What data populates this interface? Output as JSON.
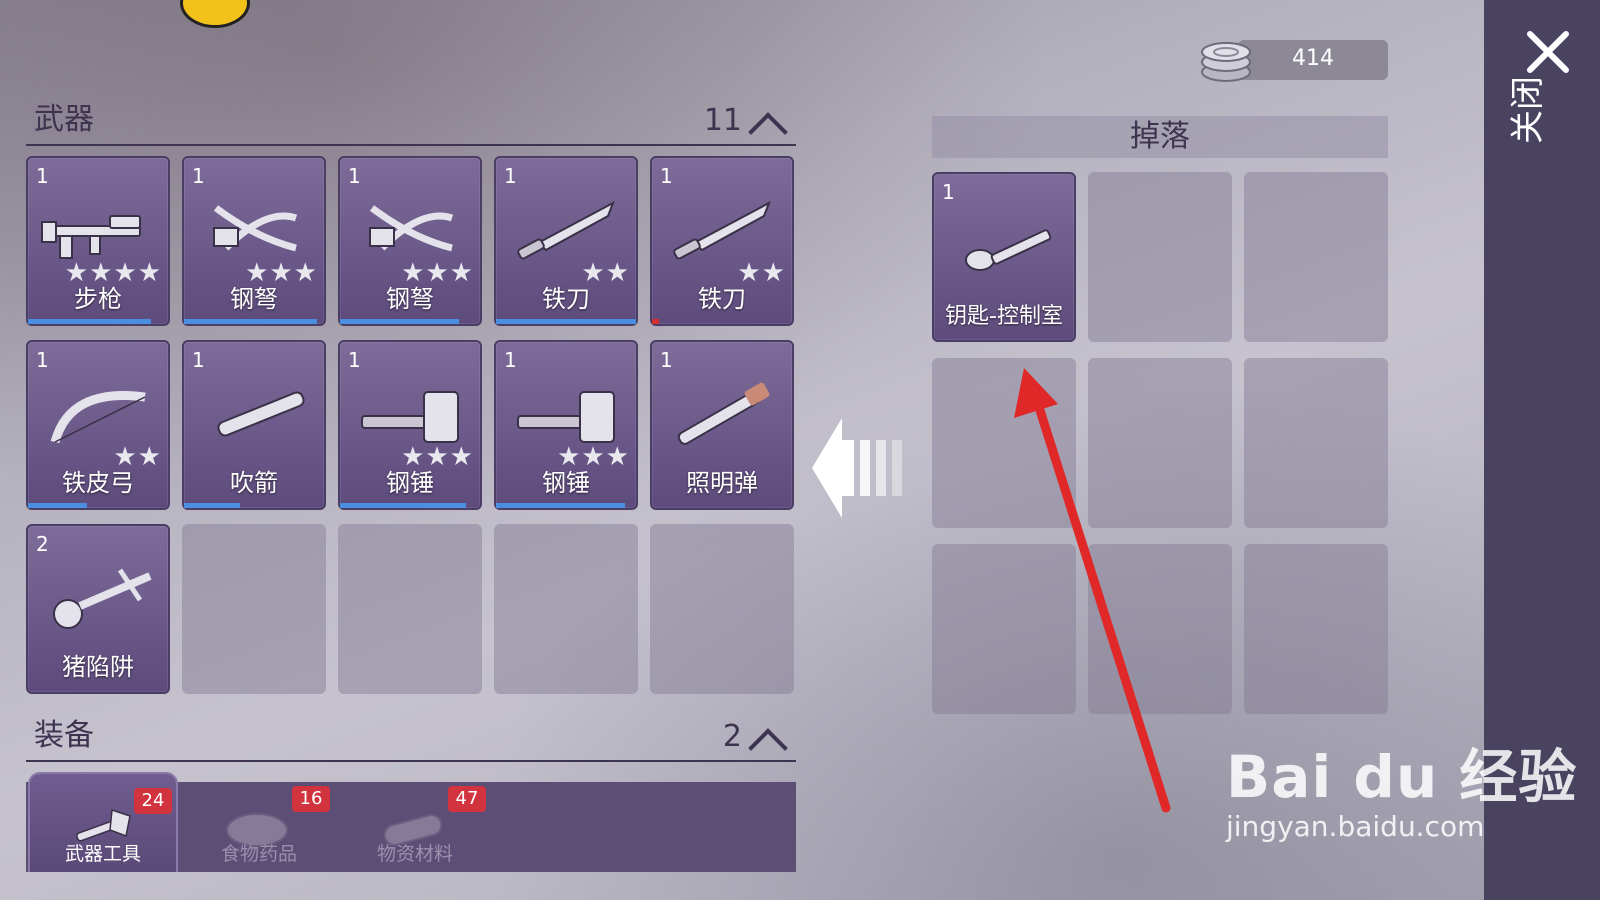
{
  "currency": {
    "icon": "coin-stack-icon",
    "value": "414"
  },
  "close": {
    "label": "关闭",
    "icon": "close-icon"
  },
  "weapons_section": {
    "title": "武器",
    "count": "11"
  },
  "equipment_section": {
    "title": "装备",
    "count": "2"
  },
  "weapon_slots": [
    {
      "qty": "1",
      "name": "步枪",
      "stars": "★★★★",
      "icon": "rifle-icon",
      "durability": 0.88
    },
    {
      "qty": "1",
      "name": "钢弩",
      "stars": "★★★",
      "icon": "crossbow-icon",
      "durability": 0.95
    },
    {
      "qty": "1",
      "name": "钢弩",
      "stars": "★★★",
      "icon": "crossbow-icon",
      "durability": 0.85
    },
    {
      "qty": "1",
      "name": "铁刀",
      "stars": "★★",
      "icon": "machete-icon",
      "durability": 1.0
    },
    {
      "qty": "1",
      "name": "铁刀",
      "stars": "★★",
      "icon": "machete-icon",
      "durability": 0.05
    },
    {
      "qty": "1",
      "name": "铁皮弓",
      "stars": "★★",
      "icon": "bow-icon",
      "durability": 0.42
    },
    {
      "qty": "1",
      "name": "吹箭",
      "stars": "",
      "icon": "blowpipe-icon",
      "durability": 0.4
    },
    {
      "qty": "1",
      "name": "钢锤",
      "stars": "★★★",
      "icon": "hammer-icon",
      "durability": 0.9
    },
    {
      "qty": "1",
      "name": "钢锤",
      "stars": "★★★",
      "icon": "hammer-icon",
      "durability": 0.92
    },
    {
      "qty": "1",
      "name": "照明弹",
      "stars": "",
      "icon": "flare-icon",
      "durability": 0
    },
    {
      "qty": "2",
      "name": "猪陷阱",
      "stars": "",
      "icon": "pig-trap-icon",
      "durability": 0
    }
  ],
  "drop": {
    "title": "掉落",
    "items": [
      {
        "qty": "1",
        "name": "钥匙-控制室",
        "icon": "key-icon"
      }
    ]
  },
  "categories": [
    {
      "label": "武器工具",
      "badge": "24",
      "icon": "axe-tool-icon",
      "active": true
    },
    {
      "label": "食物药品",
      "badge": "16",
      "icon": "meat-icon",
      "active": false
    },
    {
      "label": "物资材料",
      "badge": "47",
      "icon": "log-icon",
      "active": false
    }
  ],
  "watermark": {
    "line1": "Bai du 经验",
    "line2": "jingyan.baidu.com"
  },
  "colors": {
    "slot_bg": "#6a5888",
    "durability_bar": "#4b8fe0",
    "badge": "#d1333f",
    "annotation_arrow": "#e02828"
  }
}
